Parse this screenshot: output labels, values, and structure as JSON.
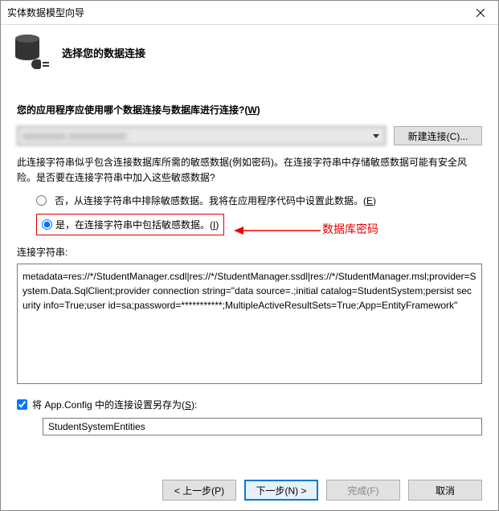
{
  "titlebar": {
    "text": "实体数据模型向导"
  },
  "header": {
    "title": "选择您的数据连接"
  },
  "question": {
    "prefix": "您的应用程序应使用哪个数据连接与数据库进行连接?(",
    "key": "W",
    "suffix": ")"
  },
  "new_conn_btn": "新建连接(C)...",
  "warning": "此连接字符串似乎包含连接数据库所需的敏感数据(例如密码)。在连接字符串中存储敏感数据可能有安全风险。是否要在连接字符串中加入这些敏感数据?",
  "radio_no": {
    "text": "否，从连接字符串中排除敏感数据。我将在应用程序代码中设置此数据。(",
    "key": "E",
    "suffix": ")"
  },
  "radio_yes": {
    "text": "是，在连接字符串中包括敏感数据。(",
    "key": "I",
    "suffix": ")"
  },
  "annotation": "数据库密码",
  "conn_label": "连接字符串:",
  "conn_string": "metadata=res://*/StudentManager.csdl|res://*/StudentManager.ssdl|res://*/StudentManager.msl;provider=System.Data.SqlClient;provider connection string=\"data source=.;initial catalog=StudentSystem;persist security info=True;user id=sa;password=***********;MultipleActiveResultSets=True;App=EntityFramework\"",
  "checkbox": {
    "text": "将 App.Config 中的连接设置另存为(",
    "key": "S",
    "suffix": "):"
  },
  "entity_name": "StudentSystemEntities",
  "buttons": {
    "prev": "< 上一步(P)",
    "next": "下一步(N) >",
    "finish": "完成(F)",
    "cancel": "取消"
  }
}
